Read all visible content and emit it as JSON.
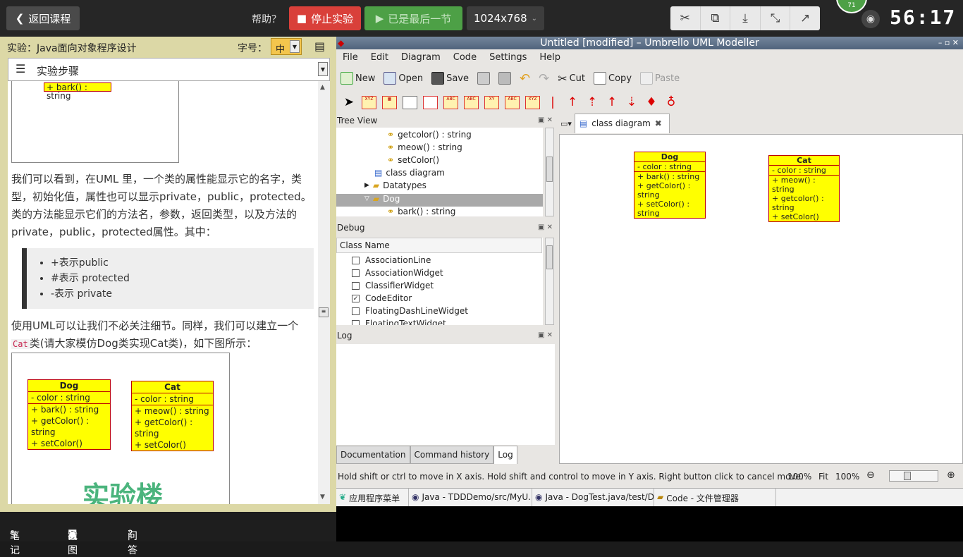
{
  "topbar": {
    "back": "返回课程",
    "help": "帮助？",
    "stop": "停止实验",
    "last": "已是最后一节",
    "resolution": "1024x768",
    "badge": "71",
    "timer": "56:17"
  },
  "left": {
    "course_title": "实验：Java面向对象程序设计",
    "font_label": "字号：",
    "font_value": "中",
    "steps_label": "实验步骤",
    "img_top_method": "+ bark() : string",
    "para1": "我们可以看到，在UML 里，一个类的属性能显示它的名字，类型，初始化值，属性也可以显示private，public，protected。 类的方法能显示它们的方法名，参数，返回类型，以及方法的private，public，protected属性。其中：",
    "bullets": [
      "+表示public",
      "#表示 protected",
      "-表示 private"
    ],
    "para2_pre": "使用UML可以让我们不必关注细节。同样，我们可以建立一个",
    "para2_code": "Cat",
    "para2_post": "类(请大家模仿Dog类实现Cat类)，如下图所示：",
    "watermark": "实验楼",
    "dog": {
      "name": "Dog",
      "attr": "- color : string",
      "methods": [
        "+ bark() : string",
        "+ getColor() : string",
        "+ setColor()"
      ]
    },
    "cat": {
      "name": "Cat",
      "attr": "- color : string",
      "methods": [
        "+ meow() : string",
        "+ getColor() : string",
        "+ setColor()"
      ]
    }
  },
  "bottombar": {
    "notes": "笔记",
    "screenshot": "截图",
    "qa": "问答"
  },
  "umbrello": {
    "title": "Untitled [modified] – Umbrello UML Modeller",
    "menu": [
      "File",
      "Edit",
      "Diagram",
      "Code",
      "Settings",
      "Help"
    ],
    "toolbar": {
      "new": "New",
      "open": "Open",
      "save": "Save",
      "cut": "Cut",
      "copy": "Copy",
      "paste": "Paste"
    },
    "tree_title": "Tree View",
    "tree_items": [
      "getcolor() : string",
      "meow() : string",
      "setColor()",
      "class diagram",
      "Datatypes",
      "Dog",
      "bark() : string"
    ],
    "debug_title": "Debug",
    "debug_header": "Class Name",
    "debug_items": [
      "AssociationLine",
      "AssociationWidget",
      "ClassifierWidget",
      "CodeEditor",
      "FloatingDashLineWidget",
      "FloatingTextWidget"
    ],
    "debug_checked_index": 3,
    "log_title": "Log",
    "log_tabs": [
      "Documentation",
      "Command history",
      "Log"
    ],
    "diagram_tab": "class diagram",
    "canvas_dog": {
      "name": "Dog",
      "attr": "- color : string",
      "methods": [
        "+ bark() : string",
        "+ getColor() : string",
        "+ setColor() : string"
      ]
    },
    "canvas_cat": {
      "name": "Cat",
      "attr": "- color : string",
      "methods": [
        "+ meow() : string",
        "+ getcolor() : string",
        "+ setColor()"
      ]
    },
    "status": "Hold shift or ctrl to move in X axis. Hold shift and control to move in Y axis. Right button click to cancel move.",
    "zoom1": "100%",
    "fit": "Fit",
    "zoom2": "100%",
    "taskbar": [
      "应用程序菜单",
      "Java - TDDDemo/src/MyU...",
      "Java - DogTest.java/test/D...",
      "Code - 文件管理器"
    ]
  }
}
